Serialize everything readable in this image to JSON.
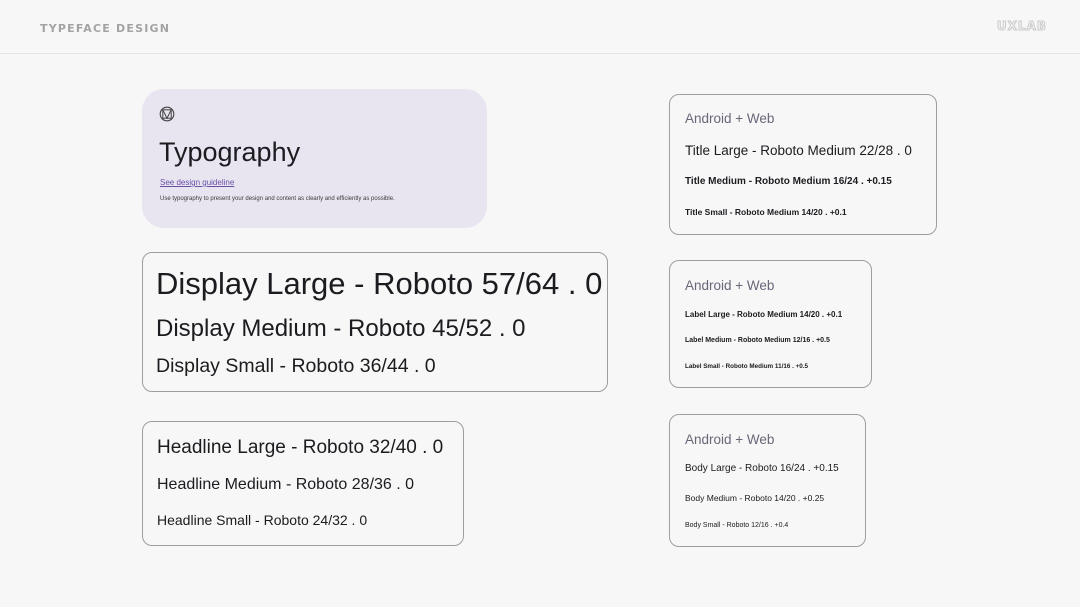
{
  "header": {
    "left_title": "TYPEFACE DESIGN",
    "right_logo": "UXLAB"
  },
  "hero": {
    "icon": "material-logo-icon",
    "title": "Typography",
    "link": "See design guideline",
    "description": "Use typography to present your design and content as clearly and efficiently as possible."
  },
  "display": {
    "large": "Display Large - Roboto 57/64 . 0",
    "medium": "Display Medium - Roboto 45/52 .  0",
    "small": "Display Small - Roboto 36/44 . 0"
  },
  "headline": {
    "large": "Headline Large - Roboto 32/40 . 0",
    "medium": "Headline Medium - Roboto 28/36 . 0",
    "small": "Headline Small - Roboto 24/32 . 0"
  },
  "title_card": {
    "heading": "Android + Web",
    "large": "Title Large - Roboto Medium 22/28 . 0",
    "medium": "Title Medium - Roboto Medium 16/24 . +0.15",
    "small": "Title Small - Roboto Medium 14/20 . +0.1"
  },
  "label_card": {
    "heading": "Android + Web",
    "large": "Label Large - Roboto Medium 14/20 . +0.1",
    "medium": "Label Medium - Roboto Medium 12/16 . +0.5",
    "small": "Label Small - Roboto Medium 11/16 . +0.5"
  },
  "body_card": {
    "heading": "Android + Web",
    "large": "Body Large - Roboto 16/24 . +0.15",
    "medium": "Body Medium - Roboto 14/20 . +0.25",
    "small": "Body Small - Roboto 12/16 . +0.4"
  },
  "colors": {
    "hero_bg": "#e8e4f0",
    "link": "#6750a4",
    "heading_muted": "#6b6578",
    "border": "#9e9e9e"
  }
}
